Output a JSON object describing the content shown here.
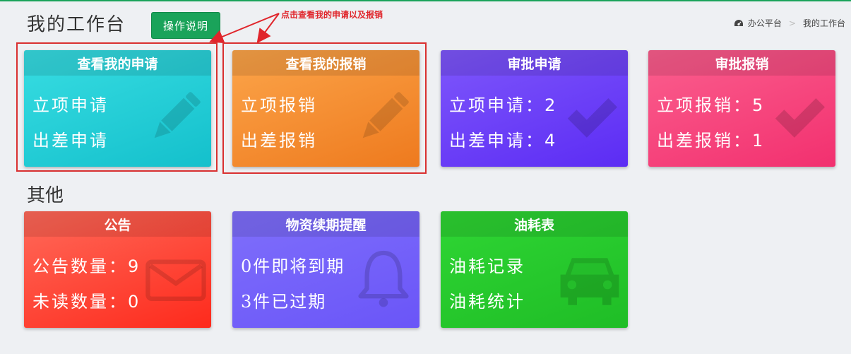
{
  "header": {
    "page_title": "我的工作台",
    "help_button": "操作说明",
    "annotation": "点击查看我的申请以及报销",
    "breadcrumb": [
      "办公平台",
      "我的工作台"
    ]
  },
  "cards_top": [
    {
      "title": "查看我的申请",
      "lines": [
        "立项申请",
        "出差申请"
      ],
      "icon": "pencil-icon",
      "color": "#21c6cf"
    },
    {
      "title": "查看我的报销",
      "lines": [
        "立项报销",
        "出差报销"
      ],
      "icon": "pencil-icon",
      "color": "#f28a2c"
    },
    {
      "title": "审批申请",
      "lines": [
        "立项申请：",
        "出差申请："
      ],
      "counts": [
        "2",
        "4"
      ],
      "icon": "check-icon",
      "color": "#6e3ff5"
    },
    {
      "title": "审批报销",
      "lines": [
        "立项报销：",
        "出差报销："
      ],
      "counts": [
        "5",
        "1"
      ],
      "icon": "check-icon",
      "color": "#f6437d"
    }
  ],
  "section_other": "其他",
  "cards_bottom": [
    {
      "title": "公告",
      "lines": [
        "公告数量：",
        "未读数量："
      ],
      "counts": [
        "9",
        "0"
      ],
      "icon": "envelope-icon",
      "color": "#fd3b30"
    },
    {
      "title": "物资续期提醒",
      "lines": [
        "0件即将到期",
        "3件已过期"
      ],
      "icon": "bell-icon",
      "color": "#7361fb"
    },
    {
      "title": "油耗表",
      "lines": [
        "油耗记录",
        "油耗统计"
      ],
      "icon": "car-icon",
      "color": "#27c62e"
    }
  ]
}
